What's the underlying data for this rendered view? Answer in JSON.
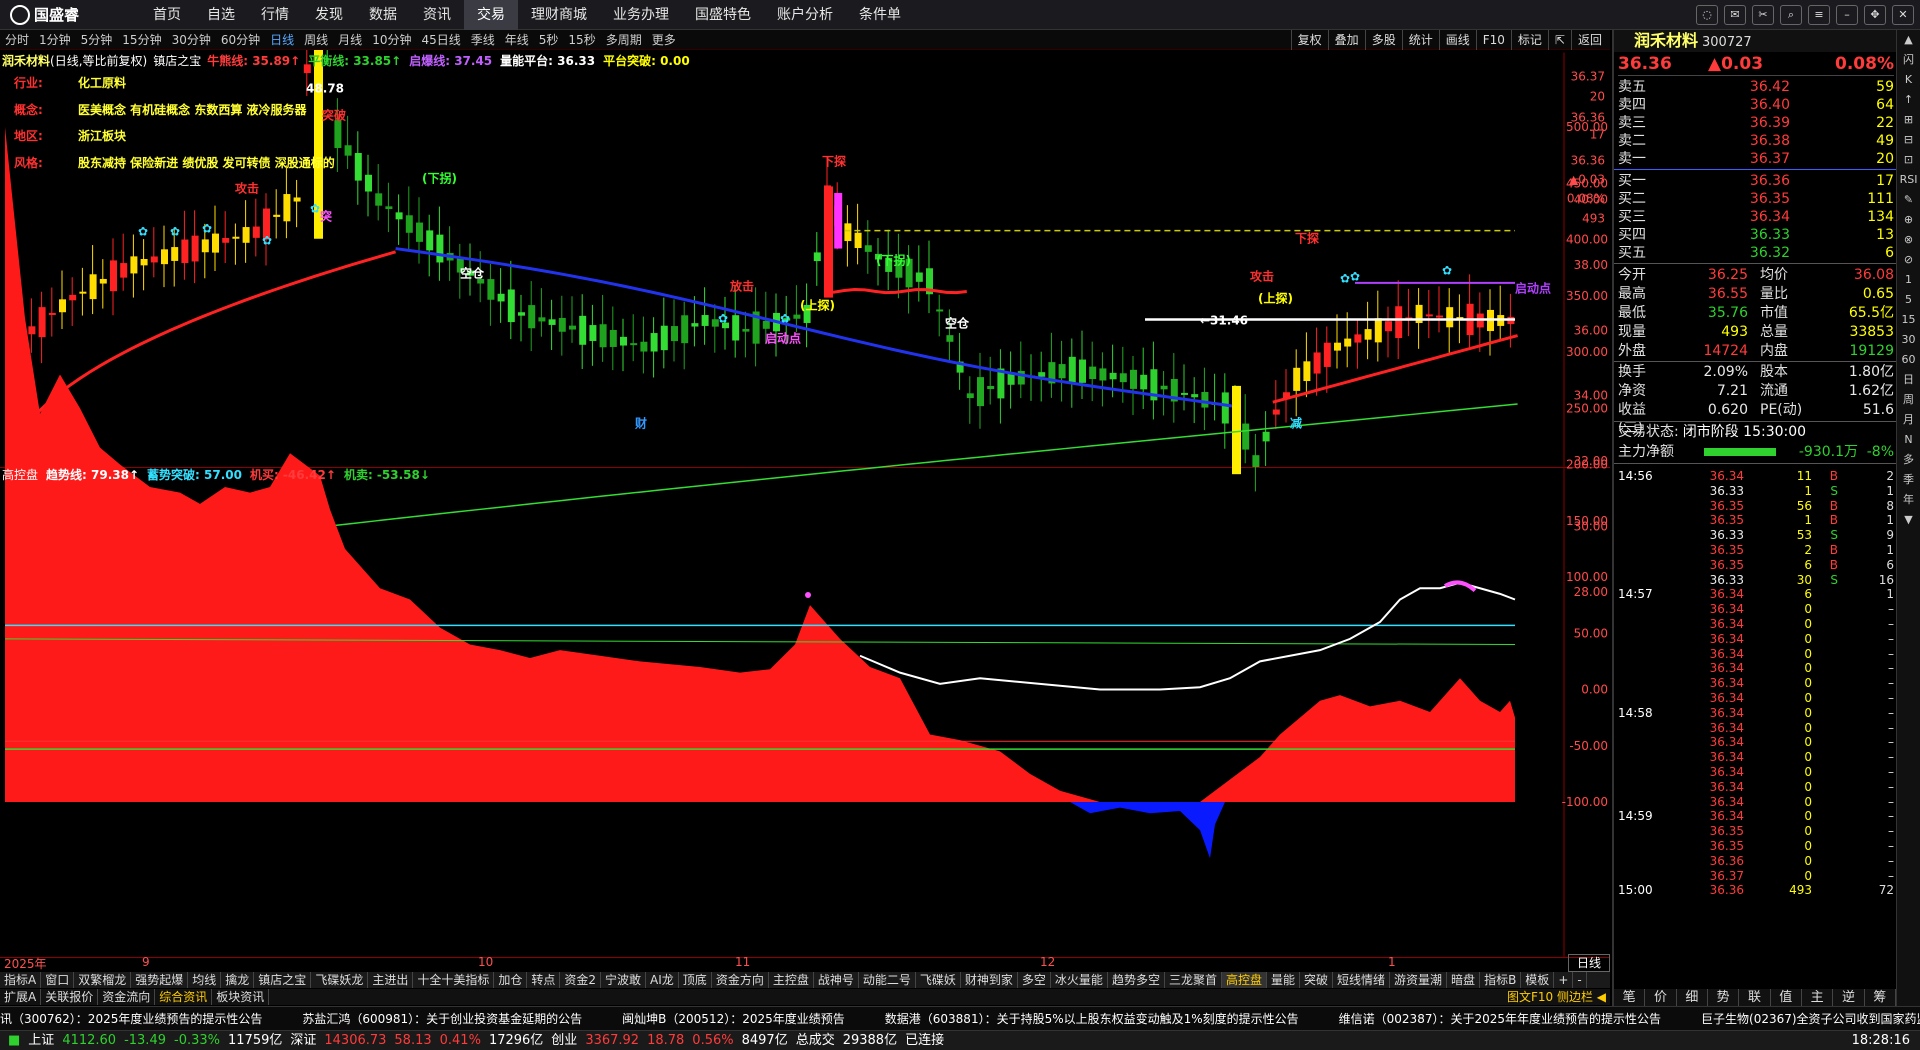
{
  "app": {
    "logo": "国盛睿",
    "menu": [
      "首页",
      "自选",
      "行情",
      "发现",
      "数据",
      "资讯",
      "交易",
      "理财商城",
      "业务办理",
      "国盛特色",
      "账户分析",
      "条件单"
    ],
    "active_menu": "交易"
  },
  "periods": {
    "items": [
      "分时",
      "1分钟",
      "5分钟",
      "15分钟",
      "30分钟",
      "60分钟",
      "日线",
      "周线",
      "月线",
      "10分钟",
      "45日线",
      "季线",
      "年线",
      "5秒",
      "15秒",
      "多周期",
      "更多"
    ],
    "active": "日线",
    "tools": [
      "复权",
      "叠加",
      "多股",
      "统计",
      "画线",
      "F10",
      "标记",
      "⇱",
      "返回"
    ]
  },
  "main_legend": {
    "stock": "润禾材料",
    "desc": "(日线,等比前复权)",
    "indicator": "镇店之宝",
    "items": [
      {
        "t": "牛熊线: 35.89↑",
        "c": "#ff3b3b"
      },
      {
        "t": "平衡线: 33.85↑",
        "c": "#2fd12f"
      },
      {
        "t": "启爆线: 37.45",
        "c": "#c060ff"
      },
      {
        "t": "量能平台: 36.33",
        "c": "#ffffff"
      },
      {
        "t": "平台突破: 0.00",
        "c": "#ffff00"
      }
    ]
  },
  "info_tags": [
    {
      "k": "行业:",
      "v": "化工原料"
    },
    {
      "k": "概念:",
      "v": "医美概念 有机硅概念 东数西算 液冷服务器"
    },
    {
      "k": "地区:",
      "v": "浙江板块"
    },
    {
      "k": "风格:",
      "v": "股东减持 保险新进 绩优股 发可转债 深股通标的"
    }
  ],
  "main_axis": [
    "36.37",
    "20",
    "36.36",
    "17",
    "36.36",
    "▲0.03",
    "0.08%",
    "493",
    "40.00",
    "38.00",
    "36.00",
    "34.00",
    "32.00",
    "30.00",
    "28.00"
  ],
  "sub_legend": {
    "name": "高控盘",
    "items": [
      {
        "t": "趋势线: 79.38↑",
        "c": "#ffffff"
      },
      {
        "t": "蓄势突破: 57.00",
        "c": "#33e0ff"
      },
      {
        "t": "机买: -46.42↑",
        "c": "#ff3b3b"
      },
      {
        "t": "机卖: -53.58↓",
        "c": "#2fd12f"
      }
    ]
  },
  "sub_axis": [
    "500.00",
    "450.00",
    "400.00",
    "350.00",
    "300.00",
    "250.00",
    "200.00",
    "150.00",
    "100.00",
    "50.00",
    "0.00",
    "-50.00",
    "-100.00"
  ],
  "chart_labels": {
    "high": "48.78",
    "low": "←31.46",
    "cai": "财",
    "jian": "减",
    "dots": "启动点",
    "xt": "(下拐)",
    "sx": "(上探)",
    "kc": "空仓",
    "gj": "攻击",
    "fj": "放击",
    "xtx": "下探",
    "tp": "突破",
    "du": "突"
  },
  "dates": [
    "2025年",
    "9",
    "10",
    "11",
    "12",
    "1"
  ],
  "date_tab": "日线",
  "idx_tabs": [
    "指标A",
    "窗口",
    "双繁榴龙",
    "强势起爆",
    "均线",
    "擒龙",
    "镇店之宝",
    "飞碟妖龙",
    "主进出",
    "十全十美指标",
    "加仓",
    "转点",
    "资金2",
    "宁波敢",
    "AI龙",
    "顶底",
    "资金方向",
    "主控盘",
    "战神号",
    "动能二号",
    "飞碟妖",
    "财神到家",
    "多空",
    "冰火量能",
    "趋势多空",
    "三龙聚首",
    "高控盘",
    "量能",
    "突破",
    "短线情绪",
    "游资量潮",
    "暗盘",
    "指标B",
    "模板",
    "+",
    "-"
  ],
  "idx_active": "高控盘",
  "bottom_tabs": [
    "扩展A",
    "关联报价",
    "资金流向",
    "综合资讯",
    "板块资讯"
  ],
  "bottom_active": "综合资讯",
  "bottom_right": "图文F10 侧边栏 ◀",
  "ticker": [
    "讯（300762）：2025年度业绩预告的提示性公告",
    "苏盐汇鸿（600981）：关于创业投资基金延期的公告",
    "闽灿坤B（200512）：2025年度业绩预告",
    "数据港（603881）：关于持股5%以上股东权益变动触及1%刻度的提示性公告",
    "维信诺（002387）：关于2025年年度业绩预告的提示性公告",
    "巨子生物(02367)全资子公司收到国家药监局颁发"
  ],
  "status": [
    {
      "t": "■",
      "c": "#2fd12f"
    },
    {
      "t": "上证",
      "c": "#ffffff"
    },
    {
      "t": "4112.60",
      "c": "#2fd12f"
    },
    {
      "t": "-13.49",
      "c": "#2fd12f"
    },
    {
      "t": "-0.33%",
      "c": "#2fd12f"
    },
    {
      "t": "11759亿",
      "c": "#ffffff"
    },
    {
      "t": "深证",
      "c": "#ffffff"
    },
    {
      "t": "14306.73",
      "c": "#ff3b3b"
    },
    {
      "t": "58.13",
      "c": "#ff3b3b"
    },
    {
      "t": "0.41%",
      "c": "#ff3b3b"
    },
    {
      "t": "17296亿",
      "c": "#ffffff"
    },
    {
      "t": "创业",
      "c": "#ffffff"
    },
    {
      "t": "3367.92",
      "c": "#ff3b3b"
    },
    {
      "t": "18.78",
      "c": "#ff3b3b"
    },
    {
      "t": "0.56%",
      "c": "#ff3b3b"
    },
    {
      "t": "8497亿",
      "c": "#ffffff"
    },
    {
      "t": "总成交",
      "c": "#ffffff"
    },
    {
      "t": "29388亿",
      "c": "#ffffff"
    },
    {
      "t": "已连接",
      "c": "#ffffff"
    }
  ],
  "clock": "18:28:16",
  "quote": {
    "name": "润禾材料",
    "code": "300727",
    "price": "36.36",
    "chg": "▲0.03",
    "pct": "0.08%",
    "asks": [
      [
        "卖五",
        "36.42",
        "59"
      ],
      [
        "卖四",
        "36.40",
        "64"
      ],
      [
        "卖三",
        "36.39",
        "22"
      ],
      [
        "卖二",
        "36.38",
        "49"
      ],
      [
        "卖一",
        "36.37",
        "20"
      ]
    ],
    "bids": [
      [
        "买一",
        "36.36",
        "17"
      ],
      [
        "买二",
        "36.35",
        "111"
      ],
      [
        "买三",
        "36.34",
        "134"
      ],
      [
        "买四",
        "36.33",
        "13"
      ],
      [
        "买五",
        "36.32",
        "6"
      ]
    ],
    "stats": [
      [
        "今开",
        "36.25",
        "均价",
        "36.08"
      ],
      [
        "最高",
        "36.55",
        "量比",
        "0.65"
      ],
      [
        "最低",
        "35.76",
        "市值",
        "65.5亿"
      ],
      [
        "现量",
        "493",
        "总量",
        "33853"
      ],
      [
        "外盘",
        "14724",
        "内盘",
        "19129"
      ],
      [
        "换手",
        "2.09%",
        "股本",
        "1.80亿"
      ],
      [
        "净资",
        "7.21",
        "流通",
        "1.62亿"
      ],
      [
        "收益(三)",
        "0.620",
        "PE(动)",
        "51.6"
      ]
    ],
    "state_label": "交易状态:",
    "state": "闭市阶段 15:30:00",
    "flow_label": "主力净额",
    "flow": "-930.1万",
    "flow_pct": "-8%"
  },
  "ticks": [
    [
      "14:56",
      "36.34",
      "11",
      "B",
      "2"
    ],
    [
      "",
      "36.33",
      "1",
      "S",
      "1"
    ],
    [
      "",
      "36.35",
      "56",
      "B",
      "8"
    ],
    [
      "",
      "36.35",
      "1",
      "B",
      "1"
    ],
    [
      "",
      "36.33",
      "53",
      "S",
      "9"
    ],
    [
      "",
      "36.35",
      "2",
      "B",
      "1"
    ],
    [
      "",
      "36.35",
      "6",
      "B",
      "6"
    ],
    [
      "",
      "36.33",
      "30",
      "S",
      "16"
    ],
    [
      "14:57",
      "36.34",
      "6",
      "",
      "1"
    ],
    [
      "",
      "36.34",
      "0",
      "",
      ""
    ],
    [
      "",
      "36.34",
      "0",
      "",
      ""
    ],
    [
      "",
      "36.34",
      "0",
      "",
      ""
    ],
    [
      "",
      "36.34",
      "0",
      "",
      ""
    ],
    [
      "",
      "36.34",
      "0",
      "",
      ""
    ],
    [
      "",
      "36.34",
      "0",
      "",
      ""
    ],
    [
      "",
      "36.34",
      "0",
      "",
      ""
    ],
    [
      "14:58",
      "36.34",
      "0",
      "",
      ""
    ],
    [
      "",
      "36.34",
      "0",
      "",
      ""
    ],
    [
      "",
      "36.34",
      "0",
      "",
      ""
    ],
    [
      "",
      "36.34",
      "0",
      "",
      ""
    ],
    [
      "",
      "36.34",
      "0",
      "",
      ""
    ],
    [
      "",
      "36.34",
      "0",
      "",
      ""
    ],
    [
      "",
      "36.34",
      "0",
      "",
      ""
    ],
    [
      "14:59",
      "36.34",
      "0",
      "",
      ""
    ],
    [
      "",
      "36.35",
      "0",
      "",
      ""
    ],
    [
      "",
      "36.35",
      "0",
      "",
      ""
    ],
    [
      "",
      "36.36",
      "0",
      "",
      ""
    ],
    [
      "",
      "36.37",
      "0",
      "",
      ""
    ],
    [
      "15:00",
      "36.36",
      "493",
      "",
      "72"
    ]
  ],
  "rp_tabs": [
    "笔",
    "价",
    "细",
    "势",
    "联",
    "值",
    "主",
    "逆",
    "筹"
  ],
  "rside": [
    "▲",
    "闪",
    "K",
    "↑",
    "⊞",
    "⊟",
    "⊡",
    "RSI",
    "✎",
    "⊕",
    "⊗",
    "⊘",
    "1",
    "5",
    "15",
    "30",
    "60",
    "日",
    "周",
    "月",
    "N",
    "多",
    "季",
    "年",
    "▼"
  ]
}
